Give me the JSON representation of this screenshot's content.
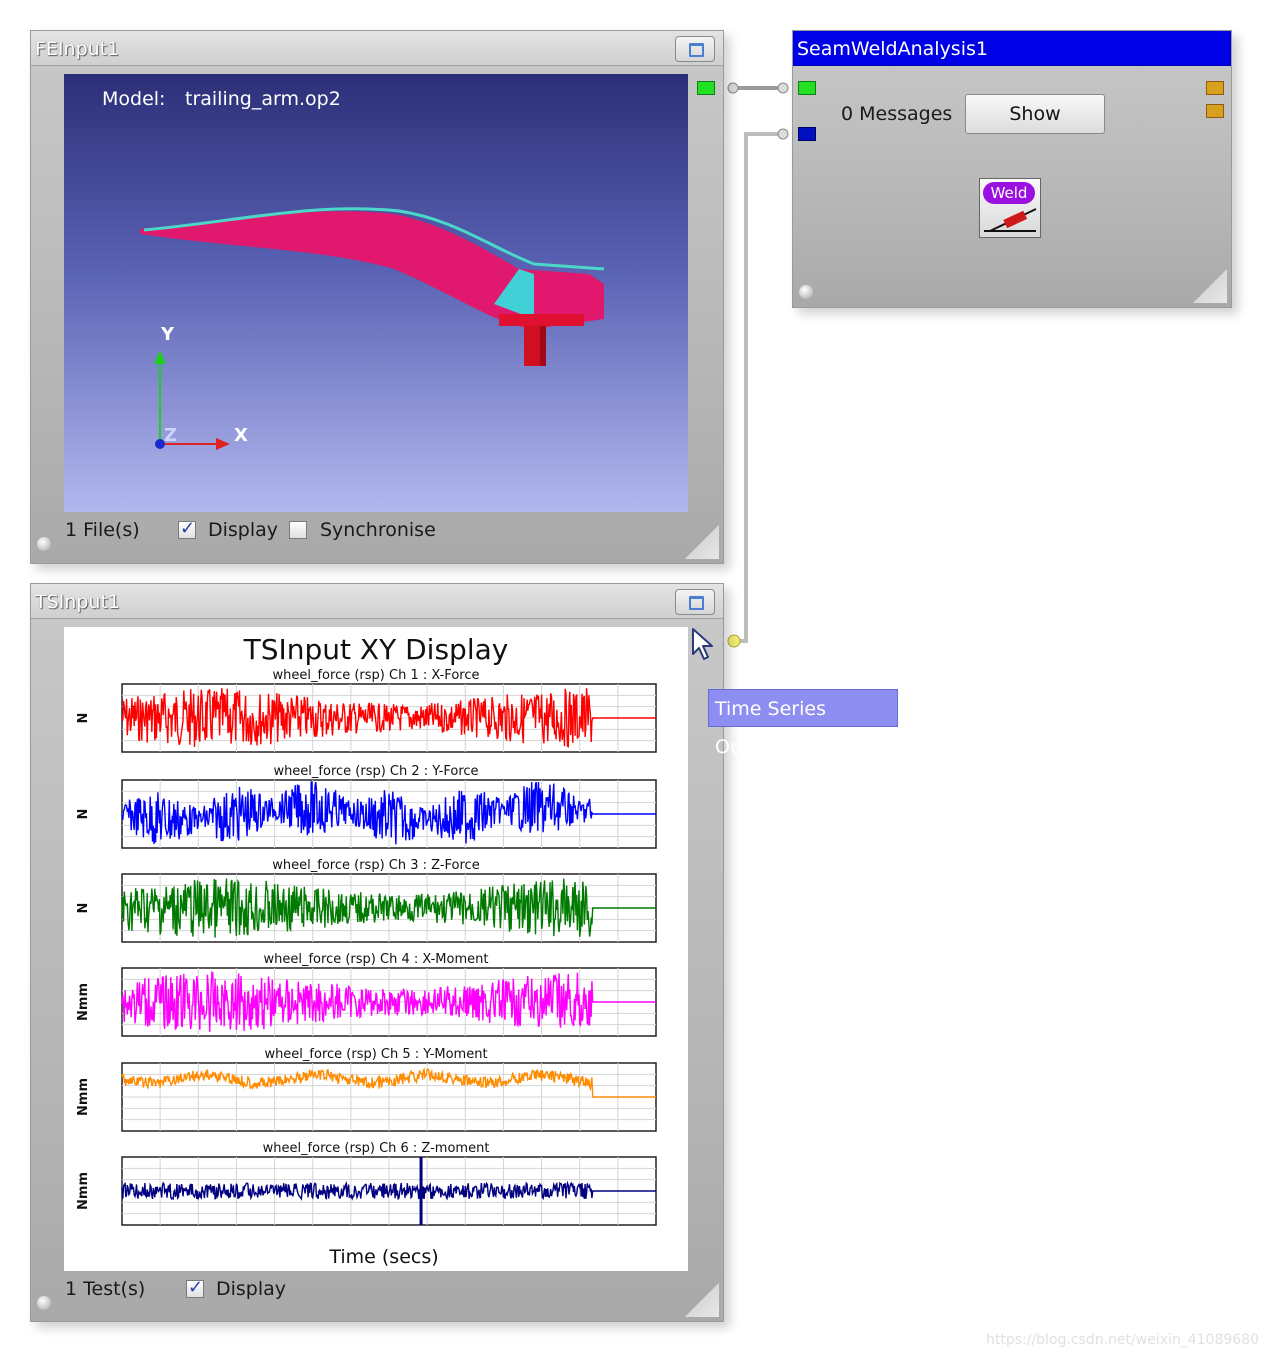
{
  "fe_panel": {
    "title": "FEInput1",
    "model_label": "Model:",
    "model_file": "trailing_arm.op2",
    "axis_y": "Y",
    "axis_z": "Z",
    "axis_x": "X",
    "files_label": "1 File(s)",
    "display_label": "Display",
    "display_checked": true,
    "sync_label": "Synchronise",
    "sync_checked": false
  },
  "seamweld_panel": {
    "title": "SeamWeldAnalysis1",
    "messages_label": "0 Messages",
    "show_button": "Show",
    "weld_icon_label": "Weld"
  },
  "ts_panel": {
    "title": "TSInput1",
    "tests_label": "1 Test(s)",
    "display_label": "Display",
    "display_checked": true
  },
  "tooltip": "Time Series Output",
  "watermark": "https://blog.csdn.net/weixin_41089680",
  "chart_data": {
    "type": "line",
    "title": "TSInput XY Display",
    "xlabel": "Time (secs)",
    "series": [
      {
        "subtitle": "wheel_force (rsp)  Ch 1 : X-Force",
        "ylabel": "N",
        "color": "#ff0000"
      },
      {
        "subtitle": "wheel_force (rsp)  Ch 2 : Y-Force",
        "ylabel": "N",
        "color": "#0000ff"
      },
      {
        "subtitle": "wheel_force (rsp)  Ch 3 : Z-Force",
        "ylabel": "N",
        "color": "#007a00"
      },
      {
        "subtitle": "wheel_force (rsp)  Ch 4 : X-Moment",
        "ylabel": "Nmm",
        "color": "#ff00ff"
      },
      {
        "subtitle": "wheel_force (rsp)  Ch 5 : Y-Moment",
        "ylabel": "Nmm",
        "color": "#ff8c00"
      },
      {
        "subtitle": "wheel_force (rsp)  Ch 6 : Z-moment",
        "ylabel": "Nmm",
        "color": "#000080"
      }
    ]
  }
}
